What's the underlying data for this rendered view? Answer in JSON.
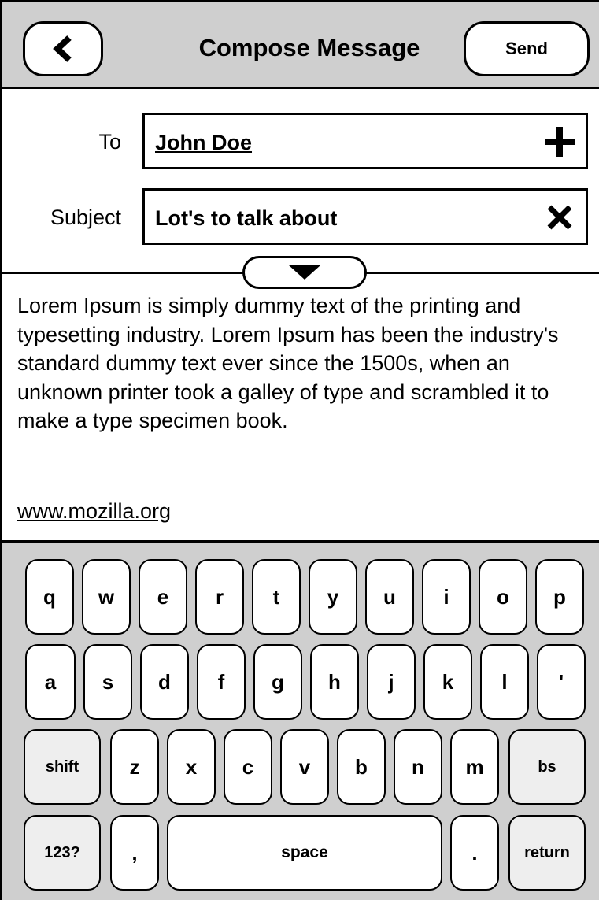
{
  "header": {
    "title": "Compose Message",
    "send_label": "Send",
    "back_icon": "chevron-left-icon"
  },
  "fields": {
    "to_label": "To",
    "to_value": "John Doe",
    "to_icon": "plus-icon",
    "subject_label": "Subject",
    "subject_value": "Lot's to talk about",
    "subject_icon": "close-icon",
    "expand_icon": "triangle-down-icon"
  },
  "body": {
    "text": "Lorem Ipsum is simply dummy text of the printing and typesetting industry. Lorem Ipsum has been the industry's standard dummy text ever since the 1500s, when an unknown printer took a galley of type and scrambled it to make a type specimen book.",
    "link": "www.mozilla.org"
  },
  "keyboard": {
    "row1": [
      "q",
      "w",
      "e",
      "r",
      "t",
      "y",
      "u",
      "i",
      "o",
      "p"
    ],
    "row2": [
      "a",
      "s",
      "d",
      "f",
      "g",
      "h",
      "j",
      "k",
      "l",
      "'"
    ],
    "row3": [
      "shift",
      "z",
      "x",
      "c",
      "v",
      "b",
      "n",
      "m",
      "bs"
    ],
    "row4": [
      "123?",
      ",",
      "space",
      ".",
      "return"
    ]
  },
  "colors": {
    "chrome_gray": "#cfcfcf",
    "modifier_key": "#eeeeee"
  }
}
